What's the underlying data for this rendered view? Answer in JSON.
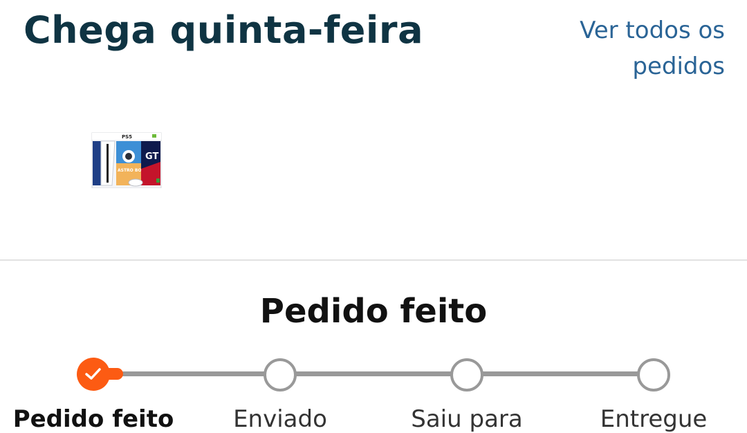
{
  "header": {
    "title": "Chega quinta-feira",
    "view_all_line1": "Ver todos os",
    "view_all_line2": "pedidos"
  },
  "product": {
    "image_icon": "ps5-bundle-product-image",
    "box_brand": "PS5",
    "box_game_1": "ASTRO BOT",
    "box_game_2": "GT"
  },
  "status": {
    "heading": "Pedido feito"
  },
  "tracker": {
    "completed_steps": 1,
    "total_steps": 4,
    "steps": [
      {
        "label": "Pedido feito",
        "state": "done"
      },
      {
        "label": "Enviado",
        "state": "pending"
      },
      {
        "label": "Saiu para",
        "state": "pending"
      },
      {
        "label": "Entregue",
        "state": "pending"
      }
    ]
  },
  "colors": {
    "accent": "#fc5b13",
    "title": "#0f3443",
    "link": "#2a6496",
    "track": "#999999"
  }
}
